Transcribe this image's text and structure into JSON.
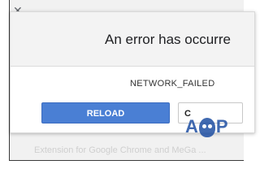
{
  "dialog": {
    "title": "An error has occurre",
    "error_code": "NETWORK_FAILED",
    "reload_label": "RELOAD",
    "cancel_label": "C"
  },
  "background": {
    "text": "Extension for Google Chrome and MeGa ..."
  },
  "colors": {
    "reload_button": "#4a7fd4",
    "dialog_header": "#f3f3f3"
  },
  "icons": {
    "close": "close-icon",
    "watermark": "appuals-logo"
  },
  "watermark": {
    "left_letter": "A",
    "right_letter": "P"
  }
}
